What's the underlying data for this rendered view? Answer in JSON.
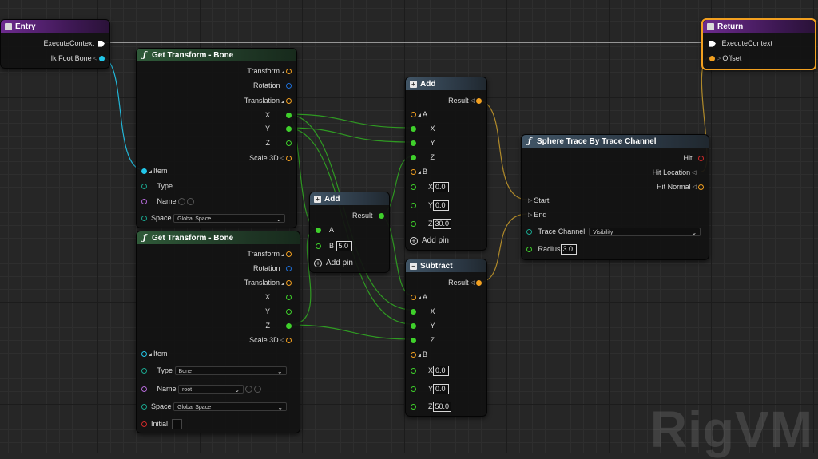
{
  "colors": {
    "exec": "#ffffff",
    "bool": "#d02a2a",
    "float": "#3fd02b",
    "vector": "#f2a020",
    "rotation": "#1f6fd6",
    "bone": "#22c6e8",
    "enum": "#1aa58e",
    "name": "#b46ad8"
  },
  "watermark": "RigVM",
  "entry": {
    "title": "Entry",
    "execute": "ExecuteContext",
    "ik_foot_bone": "Ik Foot Bone"
  },
  "return": {
    "title": "Return",
    "execute": "ExecuteContext",
    "offset": "Offset"
  },
  "get_transform_1": {
    "title": "Get Transform - Bone",
    "transform": "Transform",
    "rotation": "Rotation",
    "translation": "Translation",
    "x": "X",
    "y": "Y",
    "z": "Z",
    "scale": "Scale 3D",
    "item": "Item",
    "type": "Type",
    "name": "Name",
    "space": "Space",
    "space_value": "Global Space"
  },
  "get_transform_2": {
    "title": "Get Transform - Bone",
    "transform": "Transform",
    "rotation": "Rotation",
    "translation": "Translation",
    "x": "X",
    "y": "Y",
    "z": "Z",
    "scale": "Scale 3D",
    "item": "Item",
    "type": "Type",
    "type_value": "Bone",
    "name": "Name",
    "name_value": "root",
    "space": "Space",
    "space_value": "Global Space",
    "initial": "Initial"
  },
  "add_small": {
    "title": "Add",
    "result": "Result",
    "a": "A",
    "b": "B",
    "b_value": "5.0",
    "add_pin": "Add pin"
  },
  "add_vector": {
    "title": "Add",
    "result": "Result",
    "a": "A",
    "x": "X",
    "y": "Y",
    "z": "Z",
    "b": "B",
    "bx": "0.0",
    "by": "0.0",
    "bz": "30.0",
    "add_pin": "Add pin"
  },
  "subtract": {
    "title": "Subtract",
    "result": "Result",
    "a": "A",
    "x": "X",
    "y": "Y",
    "z": "Z",
    "b": "B",
    "bx": "0.0",
    "by": "0.0",
    "bz": "50.0"
  },
  "sphere_trace": {
    "title": "Sphere Trace By Trace Channel",
    "hit": "Hit",
    "hit_location": "Hit Location",
    "hit_normal": "Hit Normal",
    "start": "Start",
    "end": "End",
    "trace_channel": "Trace Channel",
    "trace_channel_value": "Visibility",
    "radius": "Radius",
    "radius_value": "3.0"
  }
}
